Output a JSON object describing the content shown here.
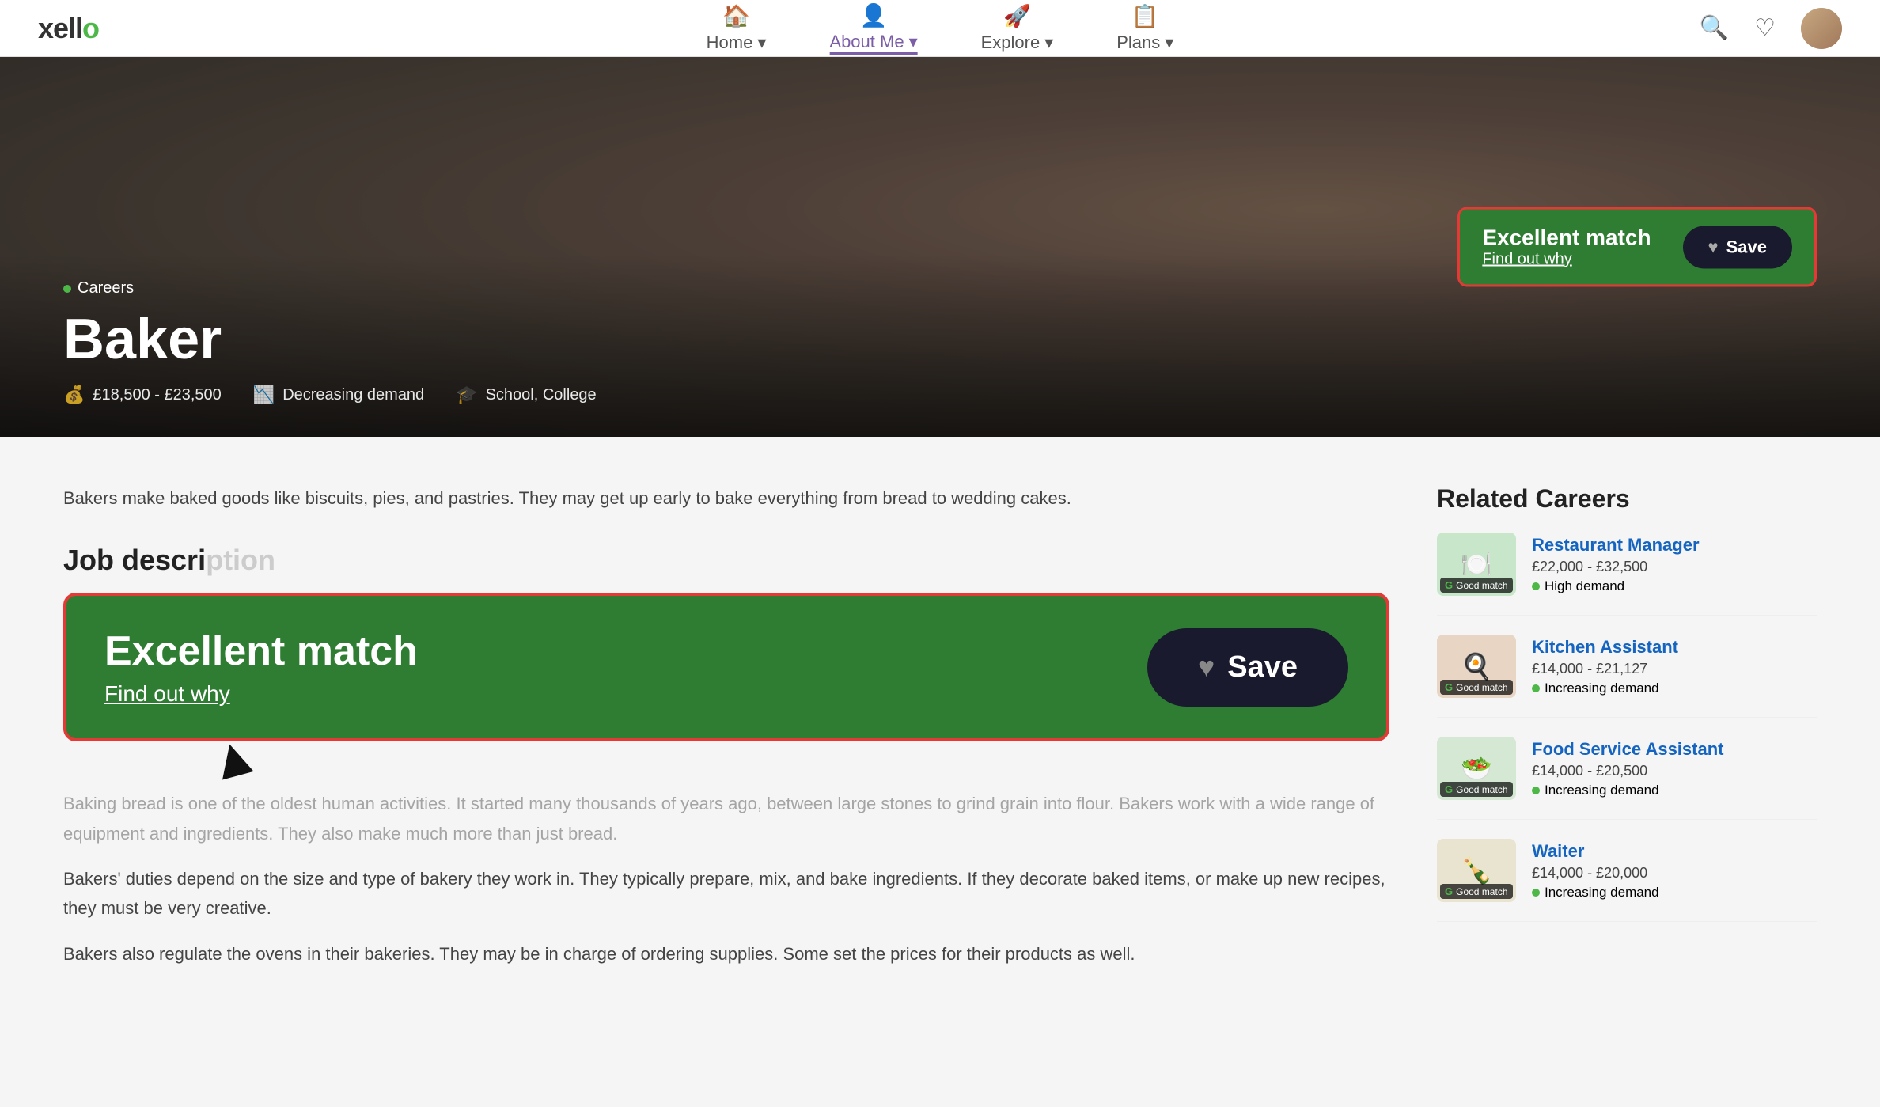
{
  "nav": {
    "logo_text": "xello",
    "items": [
      {
        "id": "home",
        "label": "Home",
        "icon": "🏠",
        "active": false
      },
      {
        "id": "about-me",
        "label": "About Me",
        "icon": "👤",
        "active": true
      },
      {
        "id": "explore",
        "label": "Explore",
        "icon": "🚀",
        "active": false
      },
      {
        "id": "plans",
        "label": "Plans",
        "icon": "📋",
        "active": false
      }
    ],
    "search_icon": "🔍",
    "heart_icon": "♡"
  },
  "hero": {
    "breadcrumb": "Careers",
    "title": "Baker",
    "salary": "£18,500 - £23,500",
    "demand": "Decreasing demand",
    "education": "School, College"
  },
  "match_box_hero": {
    "title": "Excellent match",
    "link": "Find out why",
    "save_label": "Save"
  },
  "match_box_big": {
    "title": "Excellent match",
    "link": "Find out why",
    "save_label": "Save"
  },
  "description": {
    "intro": "Bakers make baked goods like biscuits, pies, and pastries. They may get up early to bake everything from bread to wedding cakes.",
    "section_title": "Job descri",
    "para1": "Baking bread is one of the oldest human activities. It started many thousands of years ago, between large stones to grind grain into flour. Bakers work with a wide range of equipment and ingredients. They also make much more than just bread.",
    "para2": "Bakers' duties depend on the size and type of bakery they work in. They typically prepare, mix, and bake ingredients. If they decorate baked items, or make up new recipes, they must be very creative.",
    "para3": "Bakers also regulate the ovens in their bakeries. They may be in charge of ordering supplies. Some set the prices for their products as well."
  },
  "related_careers": {
    "title": "Related Careers",
    "items": [
      {
        "id": "restaurant-manager",
        "name": "Restaurant Manager",
        "salary": "£22,000 - £32,500",
        "demand": "High demand",
        "demand_type": "high",
        "match": "Good match",
        "match_level": "good",
        "thumb_bg": "#c8e6c9",
        "thumb_icon": "🍽️"
      },
      {
        "id": "kitchen-assistant",
        "name": "Kitchen Assistant",
        "salary": "£14,000 - £21,127",
        "demand": "Increasing demand",
        "demand_type": "high",
        "match": "Good match",
        "match_level": "good",
        "thumb_bg": "#e8d5c4",
        "thumb_icon": "🍳"
      },
      {
        "id": "food-service-assistant",
        "name": "Food Service Assistant",
        "salary": "£14,000 - £20,500",
        "demand": "Increasing demand",
        "demand_type": "high",
        "match": "Good match",
        "match_level": "good",
        "thumb_bg": "#d4e8d4",
        "thumb_icon": "🥗"
      },
      {
        "id": "waiter",
        "name": "Waiter",
        "salary": "£14,000 - £20,000",
        "demand": "Increasing demand",
        "demand_type": "high",
        "match": "Good match",
        "match_level": "good",
        "thumb_bg": "#e8e4d0",
        "thumb_icon": "🍾"
      }
    ]
  },
  "colors": {
    "green": "#2e7d32",
    "red_border": "#e53935",
    "link_blue": "#1565c0",
    "demand_green": "#4db848"
  }
}
